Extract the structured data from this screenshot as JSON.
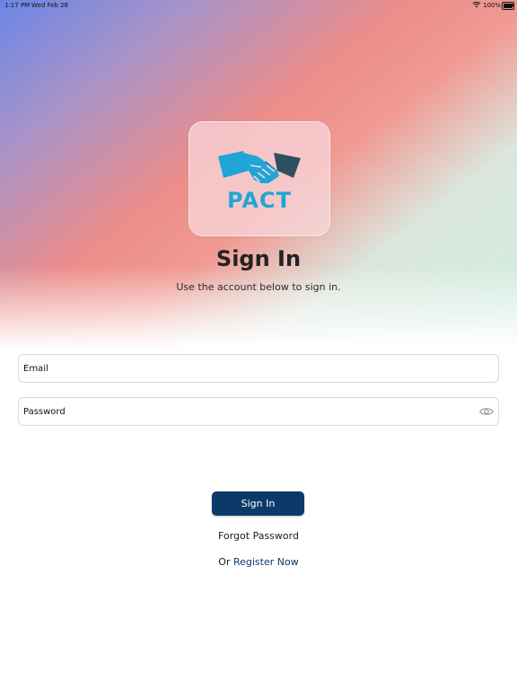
{
  "status_bar": {
    "time": "1:17 PM",
    "date": "Wed Feb 28",
    "battery": "100%"
  },
  "logo": {
    "text": "PACT",
    "colors": {
      "hand_light": "#1ea6d6",
      "hand_dark": "#2e4f5f",
      "text": "#1ea6d6"
    }
  },
  "header": {
    "title": "Sign In",
    "subtitle": "Use the account below to sign in."
  },
  "form": {
    "email_placeholder": "Email",
    "password_placeholder": "Password"
  },
  "actions": {
    "sign_in": "Sign In",
    "forgot_password": "Forgot Password",
    "register_prefix": "Or",
    "register_link": "Register Now"
  },
  "colors": {
    "primary": "#0b3a69",
    "gradient": [
      "#6b86e6",
      "#ec8d8a",
      "#cfeee0"
    ]
  }
}
